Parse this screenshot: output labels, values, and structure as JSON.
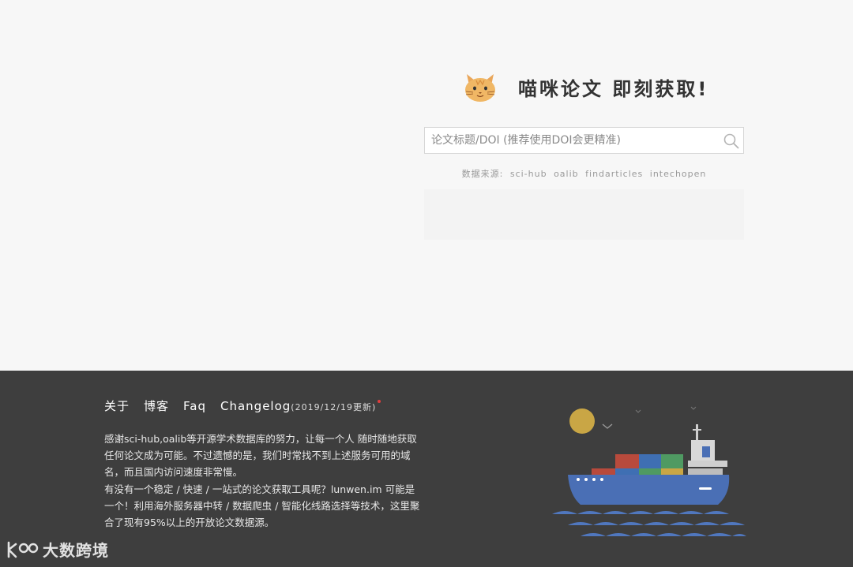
{
  "brand": {
    "title": "喵咪论文 即刻获取!"
  },
  "search": {
    "placeholder": "论文标题/DOI (推荐使用DOI会更精准)"
  },
  "sources": {
    "prefix": "数据来源:",
    "items": [
      "sci-hub",
      "oalib",
      "findarticles",
      "intechopen"
    ]
  },
  "footer": {
    "nav": {
      "about": "关于",
      "blog": "博客",
      "faq": "Faq",
      "changelog": "Changelog",
      "changelog_date": "(2019/12/19更新)"
    },
    "paragraph1": "感谢sci-hub,oalib等开源学术数据库的努力，让每一个人 随时随地获取任何论文成为可能。不过遗憾的是，我们时常找不到上述服务可用的域名，而且国内访问速度非常慢。",
    "paragraph2": "有没有一个稳定 / 快速 / 一站式的论文获取工具呢？lunwen.im 可能是一个！利用海外服务器中转 / 数据爬虫 / 智能化线路选择等技术，这里聚合了现有95%以上的开放论文数据源。"
  },
  "watermark": {
    "text": "大数跨境"
  },
  "colors": {
    "footer_bg": "#3e3e3e",
    "page_bg": "#f7f7f7",
    "sun": "#c9a645",
    "hull": "#4a6fb5",
    "notify_dot": "#e23c3c"
  }
}
